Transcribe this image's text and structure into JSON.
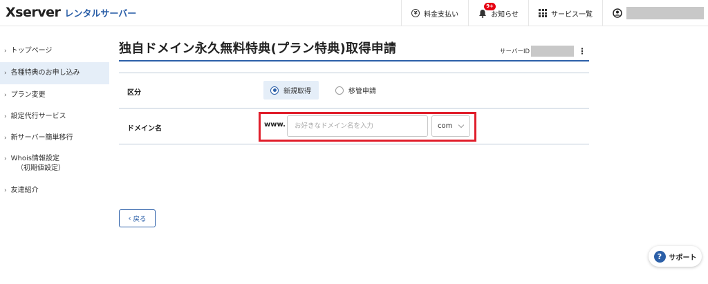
{
  "header": {
    "logo_main": "Xserver",
    "logo_sub": "レンタルサーバー",
    "nav": [
      {
        "label": "料金支払い",
        "icon": "yen-circle-icon",
        "glyph": "¥"
      },
      {
        "label": "お知らせ",
        "icon": "bell-icon",
        "badge": "9+"
      },
      {
        "label": "サービス一覧",
        "icon": "grid-icon"
      }
    ],
    "user_icon": "user-circle-icon"
  },
  "sidebar": {
    "chevron": "›",
    "items": [
      {
        "label": "トップページ"
      },
      {
        "label": "各種特典のお申し込み"
      },
      {
        "label": "プラン変更"
      },
      {
        "label": "設定代行サービス"
      },
      {
        "label": "新サーバー簡単移行"
      },
      {
        "label": "Whois情報設定",
        "sub": "（初期値設定）"
      },
      {
        "label": "友達紹介"
      }
    ]
  },
  "main": {
    "title": "独自ドメイン永久無料特典(プラン特典)取得申請",
    "server_id_label": "サーバーID",
    "form": {
      "category_label": "区分",
      "options": [
        {
          "label": "新規取得",
          "selected": true
        },
        {
          "label": "移管申請",
          "selected": false
        }
      ],
      "domain_label": "ドメイン名",
      "prefix": "www.",
      "domain_placeholder": "お好きなドメイン名を入力",
      "domain_value": "",
      "tld_value": "com"
    },
    "back_label": "戻る"
  },
  "support": {
    "label": "サポート",
    "icon_glyph": "?"
  },
  "colors": {
    "accent": "#2b5fa8",
    "highlight": "#e01e2b",
    "badge": "#e60012",
    "active_bg": "#e5eef8"
  }
}
